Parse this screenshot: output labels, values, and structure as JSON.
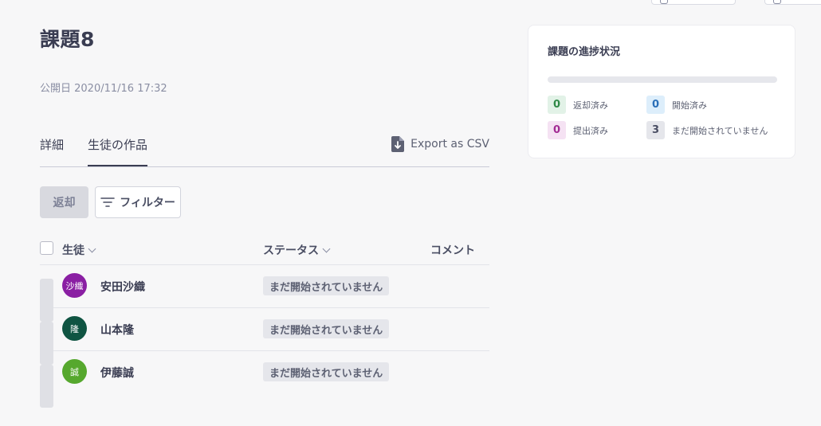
{
  "assignment": {
    "title": "課題8",
    "published": "公開日 2020/11/16 17:32"
  },
  "tabs": [
    {
      "label": "詳細"
    },
    {
      "label": "生徒の作品"
    }
  ],
  "export_label": "Export as CSV",
  "toolbar": {
    "return_label": "返却",
    "filter_label": "フィルター"
  },
  "table": {
    "headers": {
      "student": "生徒",
      "status": "ステータス",
      "comment": "コメント"
    },
    "rows": [
      {
        "avatar_text": "沙織",
        "avatar_color": "#8a1fa3",
        "name": "安田沙織",
        "status": "まだ開始されていません"
      },
      {
        "avatar_text": "隆",
        "avatar_color": "#0f5442",
        "name": "山本隆",
        "status": "まだ開始されていません"
      },
      {
        "avatar_text": "誠",
        "avatar_color": "#56a82e",
        "name": "伊藤誠",
        "status": "まだ開始されていません"
      }
    ]
  },
  "progress_card": {
    "title": "課題の進捗状況",
    "progress_fraction": 0,
    "stats": [
      {
        "count": "0",
        "label": "返却済み",
        "bg": "#e2f2e7",
        "fg": "#2f8a47"
      },
      {
        "count": "0",
        "label": "開始済み",
        "bg": "#ddeefb",
        "fg": "#2a6fb8"
      },
      {
        "count": "0",
        "label": "提出済み",
        "bg": "#f5e2f3",
        "fg": "#a22a93"
      },
      {
        "count": "3",
        "label": "まだ開始されていません",
        "bg": "#e5e6eb",
        "fg": "#4a4e63"
      }
    ]
  }
}
